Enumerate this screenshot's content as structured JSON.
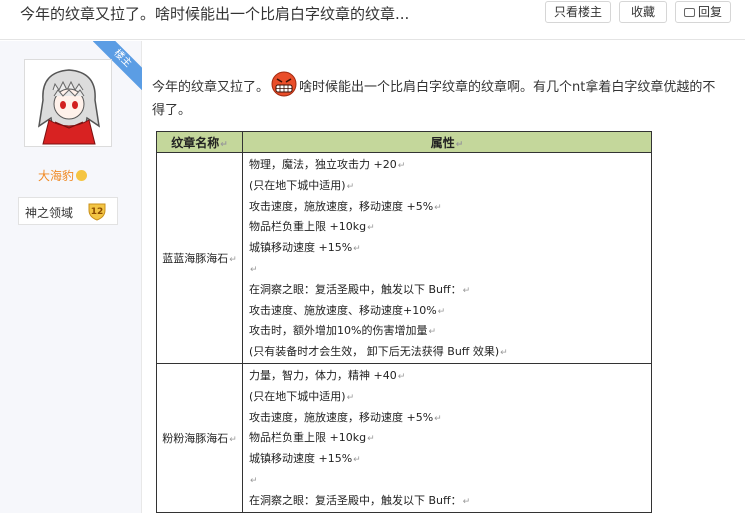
{
  "header": {
    "title": "今年的纹章又拉了。啥时候能出一个比肩白字纹章的纹章...",
    "only_author_label": "只看楼主",
    "favorite_label": "收藏",
    "reply_label": "回复"
  },
  "author": {
    "floor_badge": "楼主",
    "name": "大海豹",
    "forum_name": "神之领域",
    "level": "12"
  },
  "post": {
    "text_before_emoji": "今年的纹章又拉了。",
    "text_after_emoji": "啥时候能出一个比肩白字纹章的纹章啊。有几个nt拿着白字纹章优越的不得了。"
  },
  "table": {
    "headers": [
      "纹章名称",
      "属性"
    ],
    "rows": [
      {
        "name": "蓝蓝海豚海石",
        "lines": [
          "物理，魔法，独立攻击力 +20",
          "(只在地下城中适用)",
          "攻击速度，施放速度，移动速度 +5%",
          "物品栏负重上限 +10kg",
          "城镇移动速度 +15%",
          "",
          "在洞察之眼：复活圣殿中，触发以下 Buff：",
          "攻击速度、施放速度、移动速度+10%",
          "攻击时，额外增加10%的伤害增加量",
          " (只有装备时才会生效， 卸下后无法获得 Buff 效果)"
        ]
      },
      {
        "name": "粉粉海豚海石",
        "lines": [
          "力量，智力，体力，精神 +40",
          "(只在地下城中适用)",
          "攻击速度，施放速度，移动速度 +5%",
          "物品栏负重上限 +10kg",
          "城镇移动速度 +15%",
          "",
          "在洞察之眼：复活圣殿中，触发以下 Buff："
        ]
      }
    ]
  },
  "colors": {
    "table_header_bg": "#c4d79b",
    "username_color": "#f08a24",
    "floor_badge_bg": "#5b9de4"
  }
}
